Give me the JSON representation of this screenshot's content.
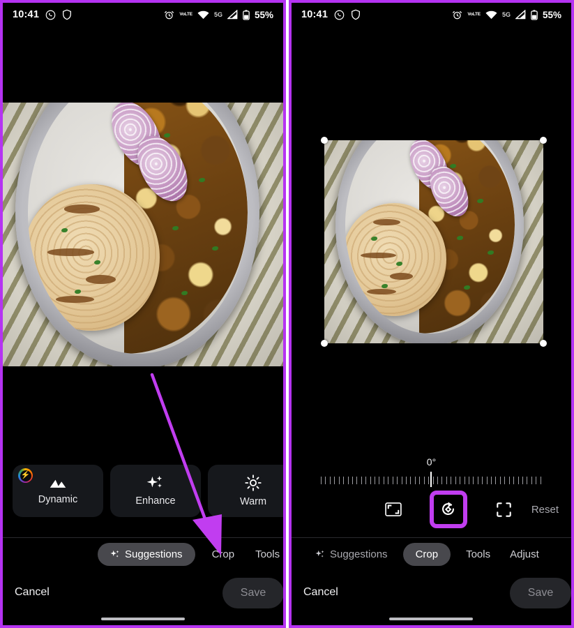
{
  "meta": {
    "app": "Google Photos Editor",
    "layout": "side-by-side phone screenshots",
    "accent_purple": "#b533f2",
    "highlight_purple": "#c13df0",
    "panel_background": "#000000"
  },
  "status_bar": {
    "time": "10:41",
    "left_icons": [
      "whatsapp-icon",
      "shield-icon"
    ],
    "right_icons": [
      "alarm-icon",
      "volte-icon",
      "wifi-icon",
      "network-5g-icon",
      "signal-icon",
      "battery-icon"
    ],
    "volte_top": "VoLTE",
    "volte_line1": "Vo",
    "volte_line2": "LTE",
    "network": "5G",
    "battery": "55%"
  },
  "photo": {
    "description": "overhead photo of a steel thali plate with laccha paratha, paneer curry and sliced red onion on a striped cloth"
  },
  "left_panel": {
    "suggestions": [
      {
        "label": "Dynamic",
        "icon": "landscape-icon",
        "badge": "ai-badge",
        "badge_glyph": "⚡"
      },
      {
        "label": "Enhance",
        "icon": "sparkle-icon",
        "badge": null,
        "badge_glyph": ""
      },
      {
        "label": "Warm",
        "icon": "sun-icon",
        "badge": null,
        "badge_glyph": ""
      },
      {
        "label": "",
        "icon": "partial-chip",
        "badge": null,
        "badge_glyph": ""
      }
    ],
    "tabs": [
      {
        "label": "Suggestions",
        "icon": "sparkle-icon",
        "selected": true
      },
      {
        "label": "Crop",
        "icon": null,
        "selected": false
      },
      {
        "label": "Tools",
        "icon": null,
        "selected": false
      }
    ],
    "cancel_label": "Cancel",
    "save_label": "Save"
  },
  "right_panel": {
    "crop": {
      "rotation_degrees": "0°",
      "handles": [
        "top-left",
        "top-right",
        "bottom-left",
        "bottom-right"
      ],
      "tools": [
        {
          "name": "aspect-ratio-icon",
          "label": "Aspect ratio",
          "highlighted": false
        },
        {
          "name": "rotate-icon",
          "label": "Rotate",
          "highlighted": true
        },
        {
          "name": "auto-straighten-icon",
          "label": "Auto straighten",
          "highlighted": false
        }
      ],
      "reset_label": "Reset"
    },
    "tabs": [
      {
        "label": "Suggestions",
        "icon": "sparkle-icon",
        "selected": false
      },
      {
        "label": "Crop",
        "icon": null,
        "selected": true
      },
      {
        "label": "Tools",
        "icon": null,
        "selected": false
      },
      {
        "label": "Adjust",
        "icon": null,
        "selected": false
      }
    ],
    "cancel_label": "Cancel",
    "save_label": "Save"
  },
  "annotation": {
    "type": "arrow",
    "color": "#c13df0",
    "points_to": "Crop tab in left panel"
  }
}
